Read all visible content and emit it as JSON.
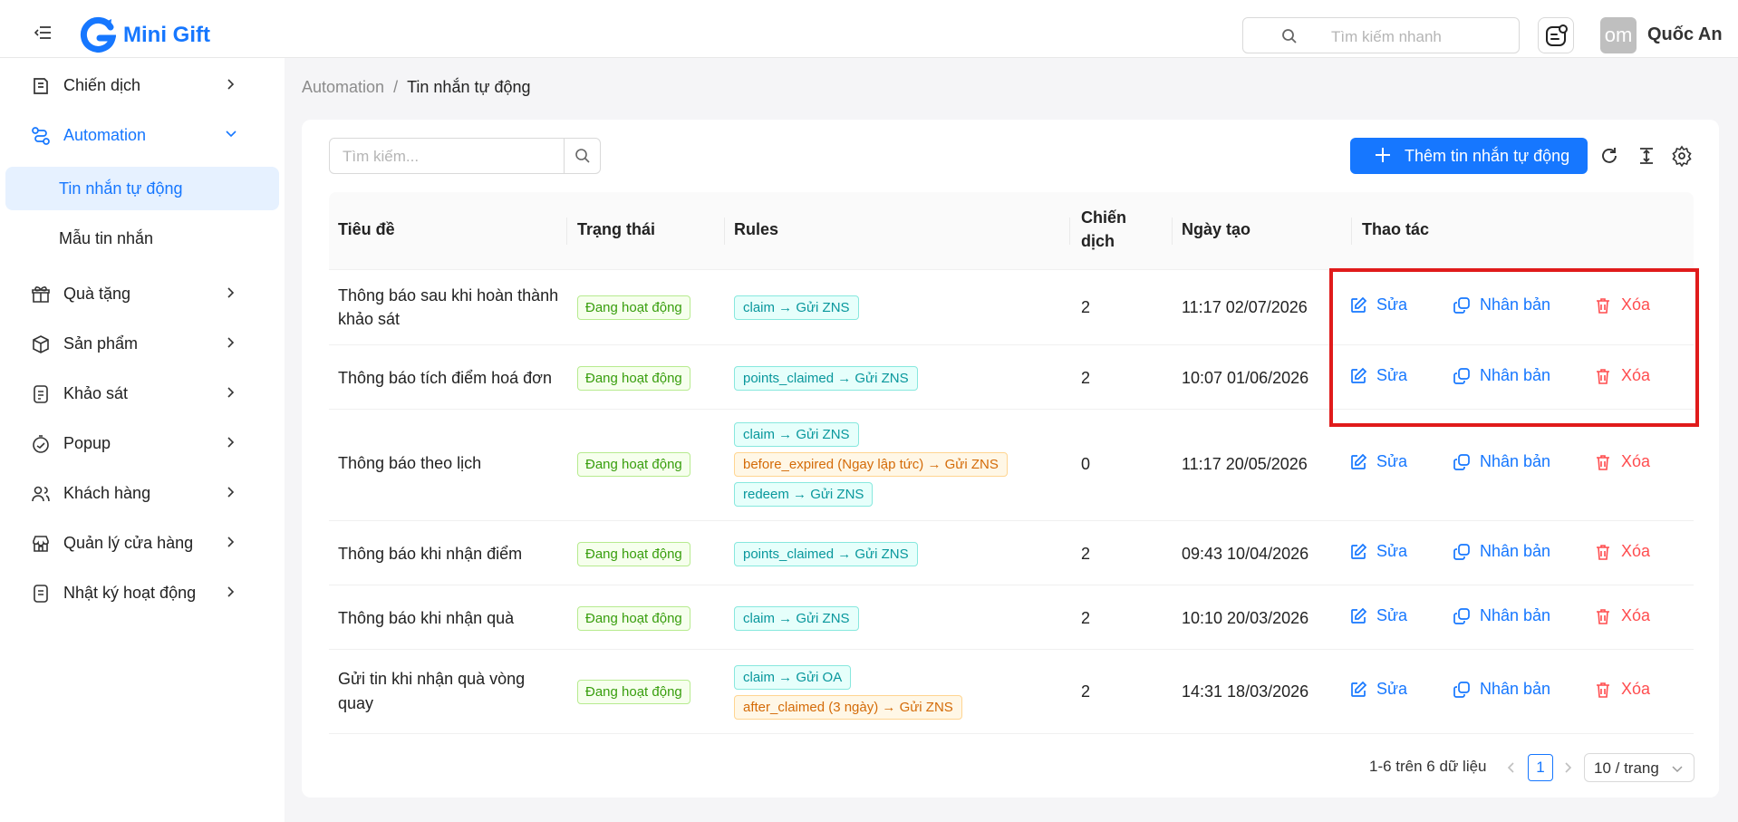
{
  "header": {
    "brand": "Mini Gift",
    "search_placeholder": "Tìm kiếm nhanh",
    "avatar_text": "om",
    "user_name": "Quốc An"
  },
  "sidebar": {
    "items": [
      {
        "label": "Chiến dịch",
        "icon": "campaign-icon"
      },
      {
        "label": "Automation",
        "icon": "automation-icon",
        "expanded": true
      },
      {
        "label": "Quà tặng",
        "icon": "gift-icon"
      },
      {
        "label": "Sản phẩm",
        "icon": "box-icon"
      },
      {
        "label": "Khảo sát",
        "icon": "survey-icon"
      },
      {
        "label": "Popup",
        "icon": "popup-icon"
      },
      {
        "label": "Khách hàng",
        "icon": "users-icon"
      },
      {
        "label": "Quản lý cửa hàng",
        "icon": "store-icon"
      },
      {
        "label": "Nhật ký hoạt động",
        "icon": "log-icon"
      }
    ],
    "subitems": [
      {
        "label": "Tin nhắn tự động",
        "selected": true
      },
      {
        "label": "Mẫu tin nhắn",
        "selected": false
      }
    ]
  },
  "breadcrumb": {
    "parent": "Automation",
    "separator": "/",
    "current": "Tin nhắn tự động"
  },
  "toolbar": {
    "search_placeholder": "Tìm kiếm...",
    "add_label": "Thêm tin nhắn tự động"
  },
  "table": {
    "headers": {
      "title": "Tiêu đề",
      "status": "Trạng thái",
      "rules": "Rules",
      "campaign_1": "Chiến",
      "campaign_2": "dịch",
      "created": "Ngày tạo",
      "actions": "Thao tác"
    },
    "action_labels": {
      "edit": "Sửa",
      "duplicate": "Nhân bản",
      "delete": "Xóa"
    },
    "rows": [
      {
        "title_1": "Thông báo sau khi hoàn thành",
        "title_2": "khảo sát",
        "status": "Đang hoạt động",
        "rules": [
          {
            "text": "claim → Gửi ZNS",
            "color": "cyan"
          }
        ],
        "campaign": "2",
        "created": "11:17 02/07/2026"
      },
      {
        "title_1": "Thông báo tích điểm hoá đơn",
        "title_2": "",
        "status": "Đang hoạt động",
        "rules": [
          {
            "text": "points_claimed → Gửi ZNS",
            "color": "cyan"
          }
        ],
        "campaign": "2",
        "created": "10:07 01/06/2026"
      },
      {
        "title_1": "Thông báo theo lịch",
        "title_2": "",
        "status": "Đang hoạt động",
        "rules": [
          {
            "text": "claim → Gửi ZNS",
            "color": "cyan"
          },
          {
            "text": "before_expired (Ngay lập tức) → Gửi ZNS",
            "color": "orange"
          },
          {
            "text": "redeem → Gửi ZNS",
            "color": "cyan"
          }
        ],
        "campaign": "0",
        "created": "11:17 20/05/2026"
      },
      {
        "title_1": "Thông báo khi nhận điểm",
        "title_2": "",
        "status": "Đang hoạt động",
        "rules": [
          {
            "text": "points_claimed → Gửi ZNS",
            "color": "cyan"
          }
        ],
        "campaign": "2",
        "created": "09:43 10/04/2026"
      },
      {
        "title_1": "Thông báo khi nhận quà",
        "title_2": "",
        "status": "Đang hoạt động",
        "rules": [
          {
            "text": "claim → Gửi ZNS",
            "color": "cyan"
          }
        ],
        "campaign": "2",
        "created": "10:10 20/03/2026"
      },
      {
        "title_1": "Gửi tin khi nhận quà vòng",
        "title_2": "quay",
        "status": "Đang hoạt động",
        "rules": [
          {
            "text": "claim → Gửi OA",
            "color": "cyan"
          },
          {
            "text": "after_claimed (3 ngày) → Gửi ZNS",
            "color": "orange"
          }
        ],
        "campaign": "2",
        "created": "14:31 18/03/2026"
      }
    ]
  },
  "pagination": {
    "summary": "1-6 trên 6 dữ liệu",
    "page": "1",
    "page_size": "10 / trang"
  },
  "colors": {
    "primary": "#1677ff",
    "danger": "#ff4d4f",
    "highlight": "#e01b1b"
  }
}
